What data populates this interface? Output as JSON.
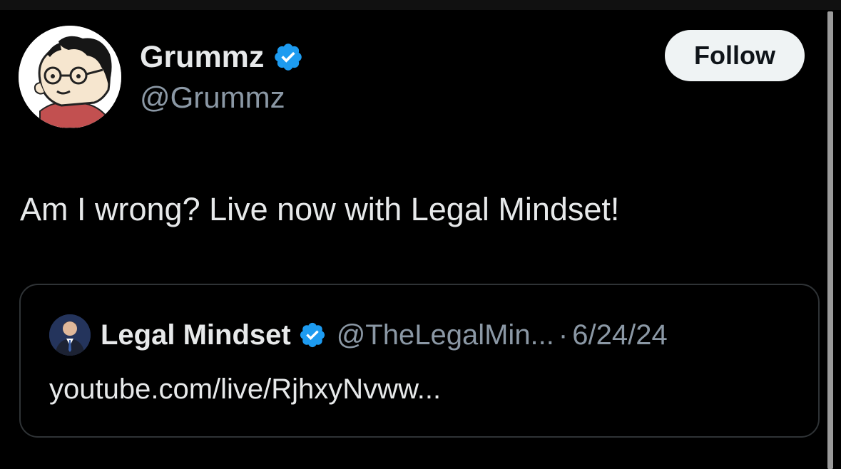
{
  "author": {
    "display_name": "Grummz",
    "handle": "@Grummz",
    "verified": true
  },
  "follow_button": {
    "label": "Follow"
  },
  "post": {
    "text": "Am I wrong? Live now with Legal Mindset!"
  },
  "quoted_post": {
    "display_name": "Legal Mindset",
    "handle": "@TheLegalMin...",
    "separator": "·",
    "date": "6/24/24",
    "link_text": "youtube.com/live/RjhxyNvww..."
  },
  "colors": {
    "background": "#000000",
    "primary_text": "#e7e9ea",
    "secondary_text": "#8b98a5",
    "verified_blue": "#1d9bf0",
    "follow_button_bg": "#eff3f4",
    "card_border": "#2f3336"
  },
  "icons": {
    "verified": "verified-badge-icon"
  }
}
